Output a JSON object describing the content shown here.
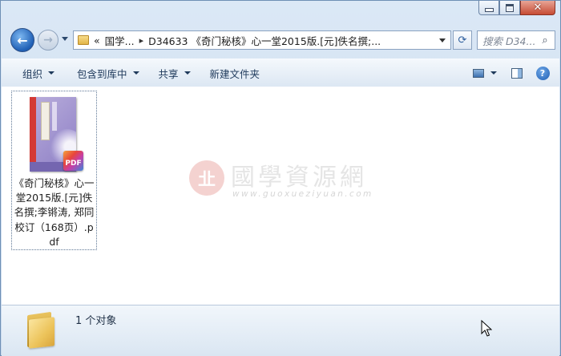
{
  "window": {
    "minimize_icon": "minimize-icon",
    "maximize_icon": "maximize-icon",
    "close_icon": "close-icon",
    "close_glyph": "✕"
  },
  "nav": {
    "back_glyph": "←",
    "forward_glyph": "→",
    "address": {
      "overflow_glyph": "«",
      "segments": [
        "国学...",
        "D34633 《奇门秘核》心一堂2015版.[元]佚名撰;..."
      ],
      "separator_glyph": "▸"
    },
    "refresh_glyph": "⟳",
    "search_placeholder": "搜索 D34...",
    "search_glyph": "⌕"
  },
  "toolbar": {
    "organize": "组织",
    "include_in_library": "包含到库中",
    "share": "共享",
    "new_folder": "新建文件夹",
    "help_glyph": "?"
  },
  "file": {
    "name": "《奇门秘核》心一堂2015版.[元]佚名撰;李锵涛, 郑同校订（168页）.pdf",
    "badge": "PDF",
    "type_icon": "pdf-file-icon"
  },
  "watermark": {
    "seal": "㐀",
    "title": "國學資源網",
    "url": "www.guoxueziyuan.com"
  },
  "status": {
    "count_text": "1 个对象"
  }
}
